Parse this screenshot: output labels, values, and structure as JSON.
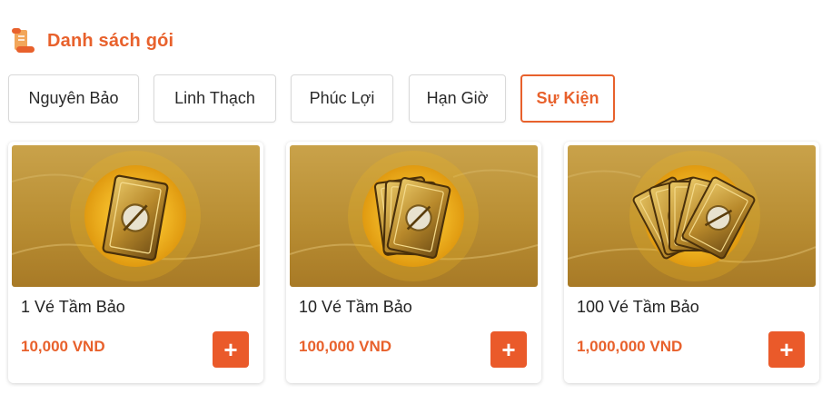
{
  "header": {
    "title": "Danh sách gói",
    "icon": "scroll-icon"
  },
  "tabs": [
    {
      "label": "Nguyên Bảo",
      "active": false
    },
    {
      "label": "Linh Thạch",
      "active": false
    },
    {
      "label": "Phúc Lợi",
      "active": false
    },
    {
      "label": "Hạn Giờ",
      "active": false
    },
    {
      "label": "Sự Kiện",
      "active": true
    }
  ],
  "packages": [
    {
      "title": "1 Vé Tầm Bảo",
      "price": "10,000 VND",
      "add_label": "+",
      "card_count": 1
    },
    {
      "title": "10 Vé Tầm Bảo",
      "price": "100,000 VND",
      "add_label": "+",
      "card_count": 3
    },
    {
      "title": "100 Vé Tầm Bảo",
      "price": "1,000,000 VND",
      "add_label": "+",
      "card_count": 5
    }
  ],
  "colors": {
    "accent": "#e8612c",
    "button": "#ea5a2a",
    "banner_gold": "#c9a24a"
  }
}
